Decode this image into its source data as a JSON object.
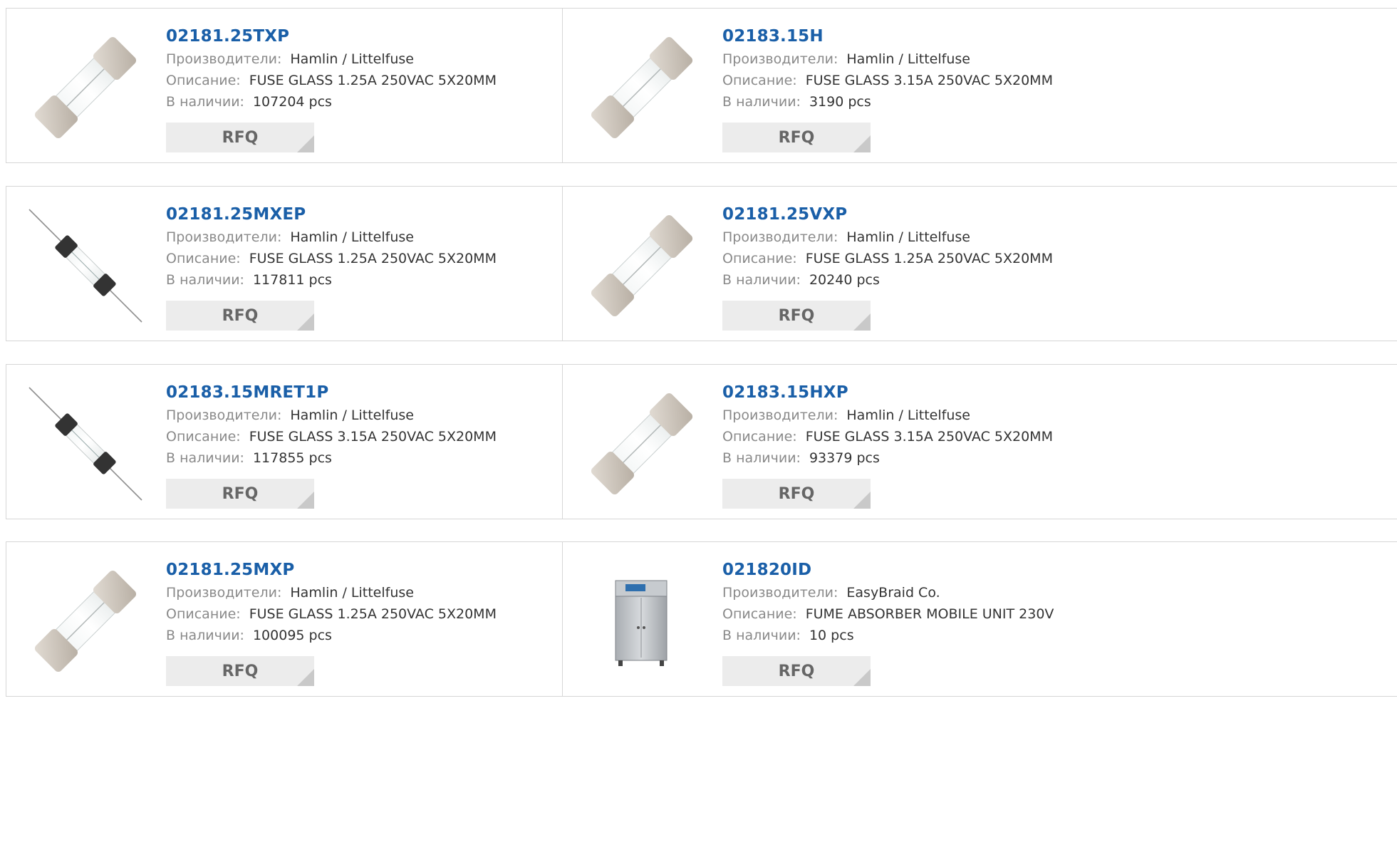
{
  "labels": {
    "manufacturer": "Производители:",
    "description": "Описание:",
    "stock": "В наличии:",
    "rfq": "RFQ"
  },
  "colors": {
    "link": "#1a5fa8",
    "label": "#8a8a8a",
    "button_bg": "#ececec"
  },
  "products": [
    {
      "part": "02181.25TXP",
      "manufacturer": "Hamlin / Littelfuse",
      "description": "FUSE GLASS 1.25A 250VAC 5X20MM",
      "stock": "107204 pcs",
      "icon": "glass-fuse-image"
    },
    {
      "part": "02183.15H",
      "manufacturer": "Hamlin / Littelfuse",
      "description": "FUSE GLASS 3.15A 250VAC 5X20MM",
      "stock": "3190 pcs",
      "icon": "glass-fuse-image"
    },
    {
      "part": "02181.25MXEP",
      "manufacturer": "Hamlin / Littelfuse",
      "description": "FUSE GLASS 1.25A 250VAC 5X20MM",
      "stock": "117811 pcs",
      "icon": "axial-fuse-image"
    },
    {
      "part": "02181.25VXP",
      "manufacturer": "Hamlin / Littelfuse",
      "description": "FUSE GLASS 1.25A 250VAC 5X20MM",
      "stock": "20240 pcs",
      "icon": "glass-fuse-image"
    },
    {
      "part": "02183.15MRET1P",
      "manufacturer": "Hamlin / Littelfuse",
      "description": "FUSE GLASS 3.15A 250VAC 5X20MM",
      "stock": "117855 pcs",
      "icon": "axial-fuse-image"
    },
    {
      "part": "02183.15HXP",
      "manufacturer": "Hamlin / Littelfuse",
      "description": "FUSE GLASS 3.15A 250VAC 5X20MM",
      "stock": "93379 pcs",
      "icon": "glass-fuse-image"
    },
    {
      "part": "02181.25MXP",
      "manufacturer": "Hamlin / Littelfuse",
      "description": "FUSE GLASS 1.25A 250VAC 5X20MM",
      "stock": "100095 pcs",
      "icon": "glass-fuse-image"
    },
    {
      "part": "021820ID",
      "manufacturer": "EasyBraid Co.",
      "description": "FUME ABSORBER MOBILE UNIT 230V",
      "stock": "10 pcs",
      "icon": "fume-absorber-image"
    }
  ]
}
